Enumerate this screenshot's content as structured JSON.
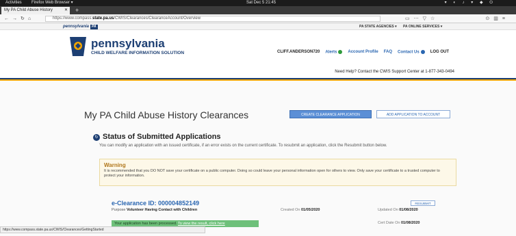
{
  "system_bar": {
    "activities": "Activities",
    "app": "Firefox Web Browser ▾",
    "clock": "Sat Dec 5 21:45"
  },
  "browser": {
    "tab_title": "My PA Child Abuse History",
    "url_prefix": "https://www.compass.",
    "url_domain": "state.pa.us",
    "url_path": "/CWIS/Clearances/ClearanceAccount/Overview",
    "status_url": "https://www.compass.state.pa.us/CWIS/Clearances/GettingStarted"
  },
  "pa_bar": {
    "logo": "pennsylvania",
    "logo_badge": "PA",
    "state_agencies": "PA STATE AGENCIES ▾",
    "online_services": "PA ONLINE SERVICES ▾"
  },
  "header": {
    "brand": "pennsylvania",
    "subtitle": "CHILD WELFARE INFORMATION SOLUTION",
    "username": "CLIFF.ANDERSON720",
    "alerts": "Alerts",
    "account_profile": "Account Profile",
    "faq": "FAQ",
    "contact_us": "Contact Us",
    "logout": "LOG OUT",
    "help_text": "Need Help? Contact the CWIS Support Center at 1-877-343-0494"
  },
  "page": {
    "title": "My PA Child Abuse History Clearances",
    "create_button": "CREATE CLEARANCE APPLICATION",
    "add_button": "ADD APPLICATION TO ACCOUNT",
    "status_title": "Status of Submitted Applications",
    "status_desc": "You can modify an application with an issued certificate, if an error exists on the current certificate. To resubmit an application, click the Resubmit button below.",
    "warning_title": "Warning",
    "warning_body": "It is recommended that you DO NOT save your certificate on a public computer. Doing so could leave your personal information open for others to view. Only save your certificate to a trusted computer to protect your information."
  },
  "application": {
    "id_label": "e-Clearance ID: 000004852149",
    "purpose_label": "Purpose",
    "purpose_value": "Volunteer Having Contact with Children",
    "created_label": "Created On",
    "created_value": "01/05/2020",
    "updated_label": "Updated On",
    "updated_value": "01/08/2020",
    "resubmit": "RESUBMIT",
    "processed_text": "Your application has been processed.",
    "processed_link": "To view the result, click here",
    "cert_label": "Cert Date On",
    "cert_value": "01/08/2020"
  },
  "colors": {
    "pa_blue": "#1d3f73",
    "accent_gold": "#f0a400",
    "link_blue": "#2a66b1",
    "success_green": "#6ec07a",
    "warning_brown": "#b0761a"
  }
}
